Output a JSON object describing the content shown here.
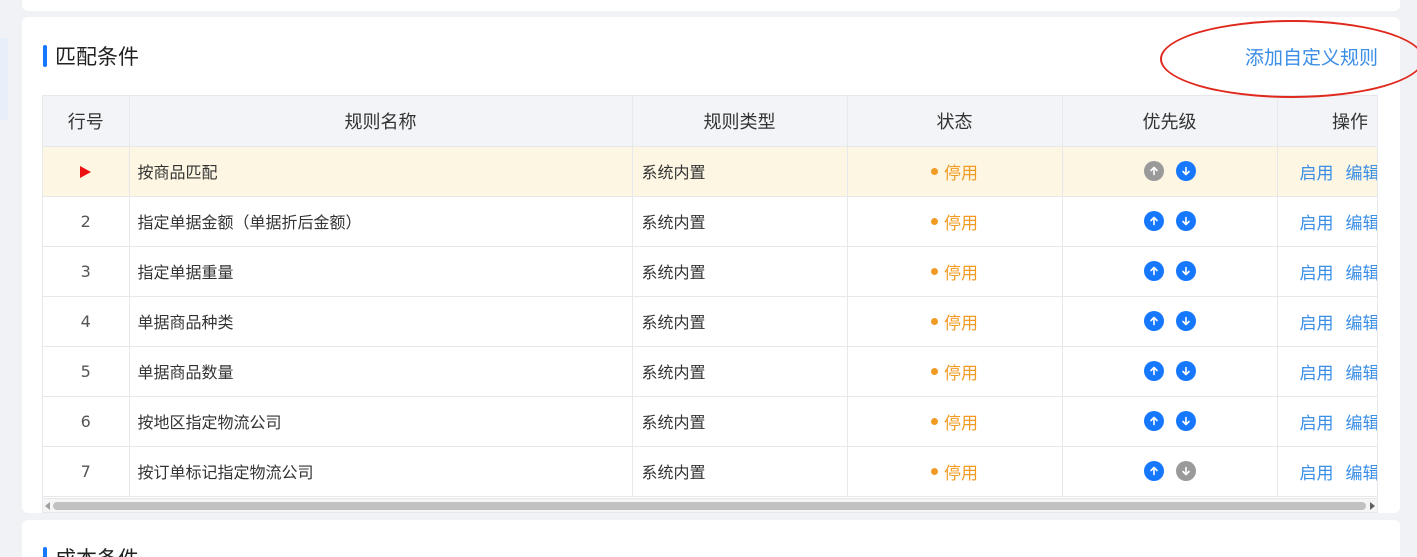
{
  "section": {
    "title": "匹配条件",
    "add_link": "添加自定义规则"
  },
  "table": {
    "headers": {
      "row_no": "行号",
      "name": "规则名称",
      "type": "规则类型",
      "status": "状态",
      "priority": "优先级",
      "ops": "操作"
    },
    "rows": [
      {
        "no": "",
        "name": "按商品匹配",
        "type": "系统内置",
        "status": "停用",
        "op_enable": "启用",
        "op_edit": "编辑"
      },
      {
        "no": "2",
        "name": "指定单据金额（单据折后金额）",
        "type": "系统内置",
        "status": "停用",
        "op_enable": "启用",
        "op_edit": "编辑"
      },
      {
        "no": "3",
        "name": "指定单据重量",
        "type": "系统内置",
        "status": "停用",
        "op_enable": "启用",
        "op_edit": "编辑"
      },
      {
        "no": "4",
        "name": "单据商品种类",
        "type": "系统内置",
        "status": "停用",
        "op_enable": "启用",
        "op_edit": "编辑"
      },
      {
        "no": "5",
        "name": "单据商品数量",
        "type": "系统内置",
        "status": "停用",
        "op_enable": "启用",
        "op_edit": "编辑"
      },
      {
        "no": "6",
        "name": "按地区指定物流公司",
        "type": "系统内置",
        "status": "停用",
        "op_enable": "启用",
        "op_edit": "编辑"
      },
      {
        "no": "7",
        "name": "按订单标记指定物流公司",
        "type": "系统内置",
        "status": "停用",
        "op_enable": "启用",
        "op_edit": "编辑"
      }
    ]
  },
  "next_section": {
    "title": "成本条件"
  },
  "colors": {
    "accent": "#1677ff",
    "link": "#3a8ee6",
    "status_disabled": "#f29b24",
    "active_row": "#fdf6e2",
    "annotation": "#e0281d"
  }
}
